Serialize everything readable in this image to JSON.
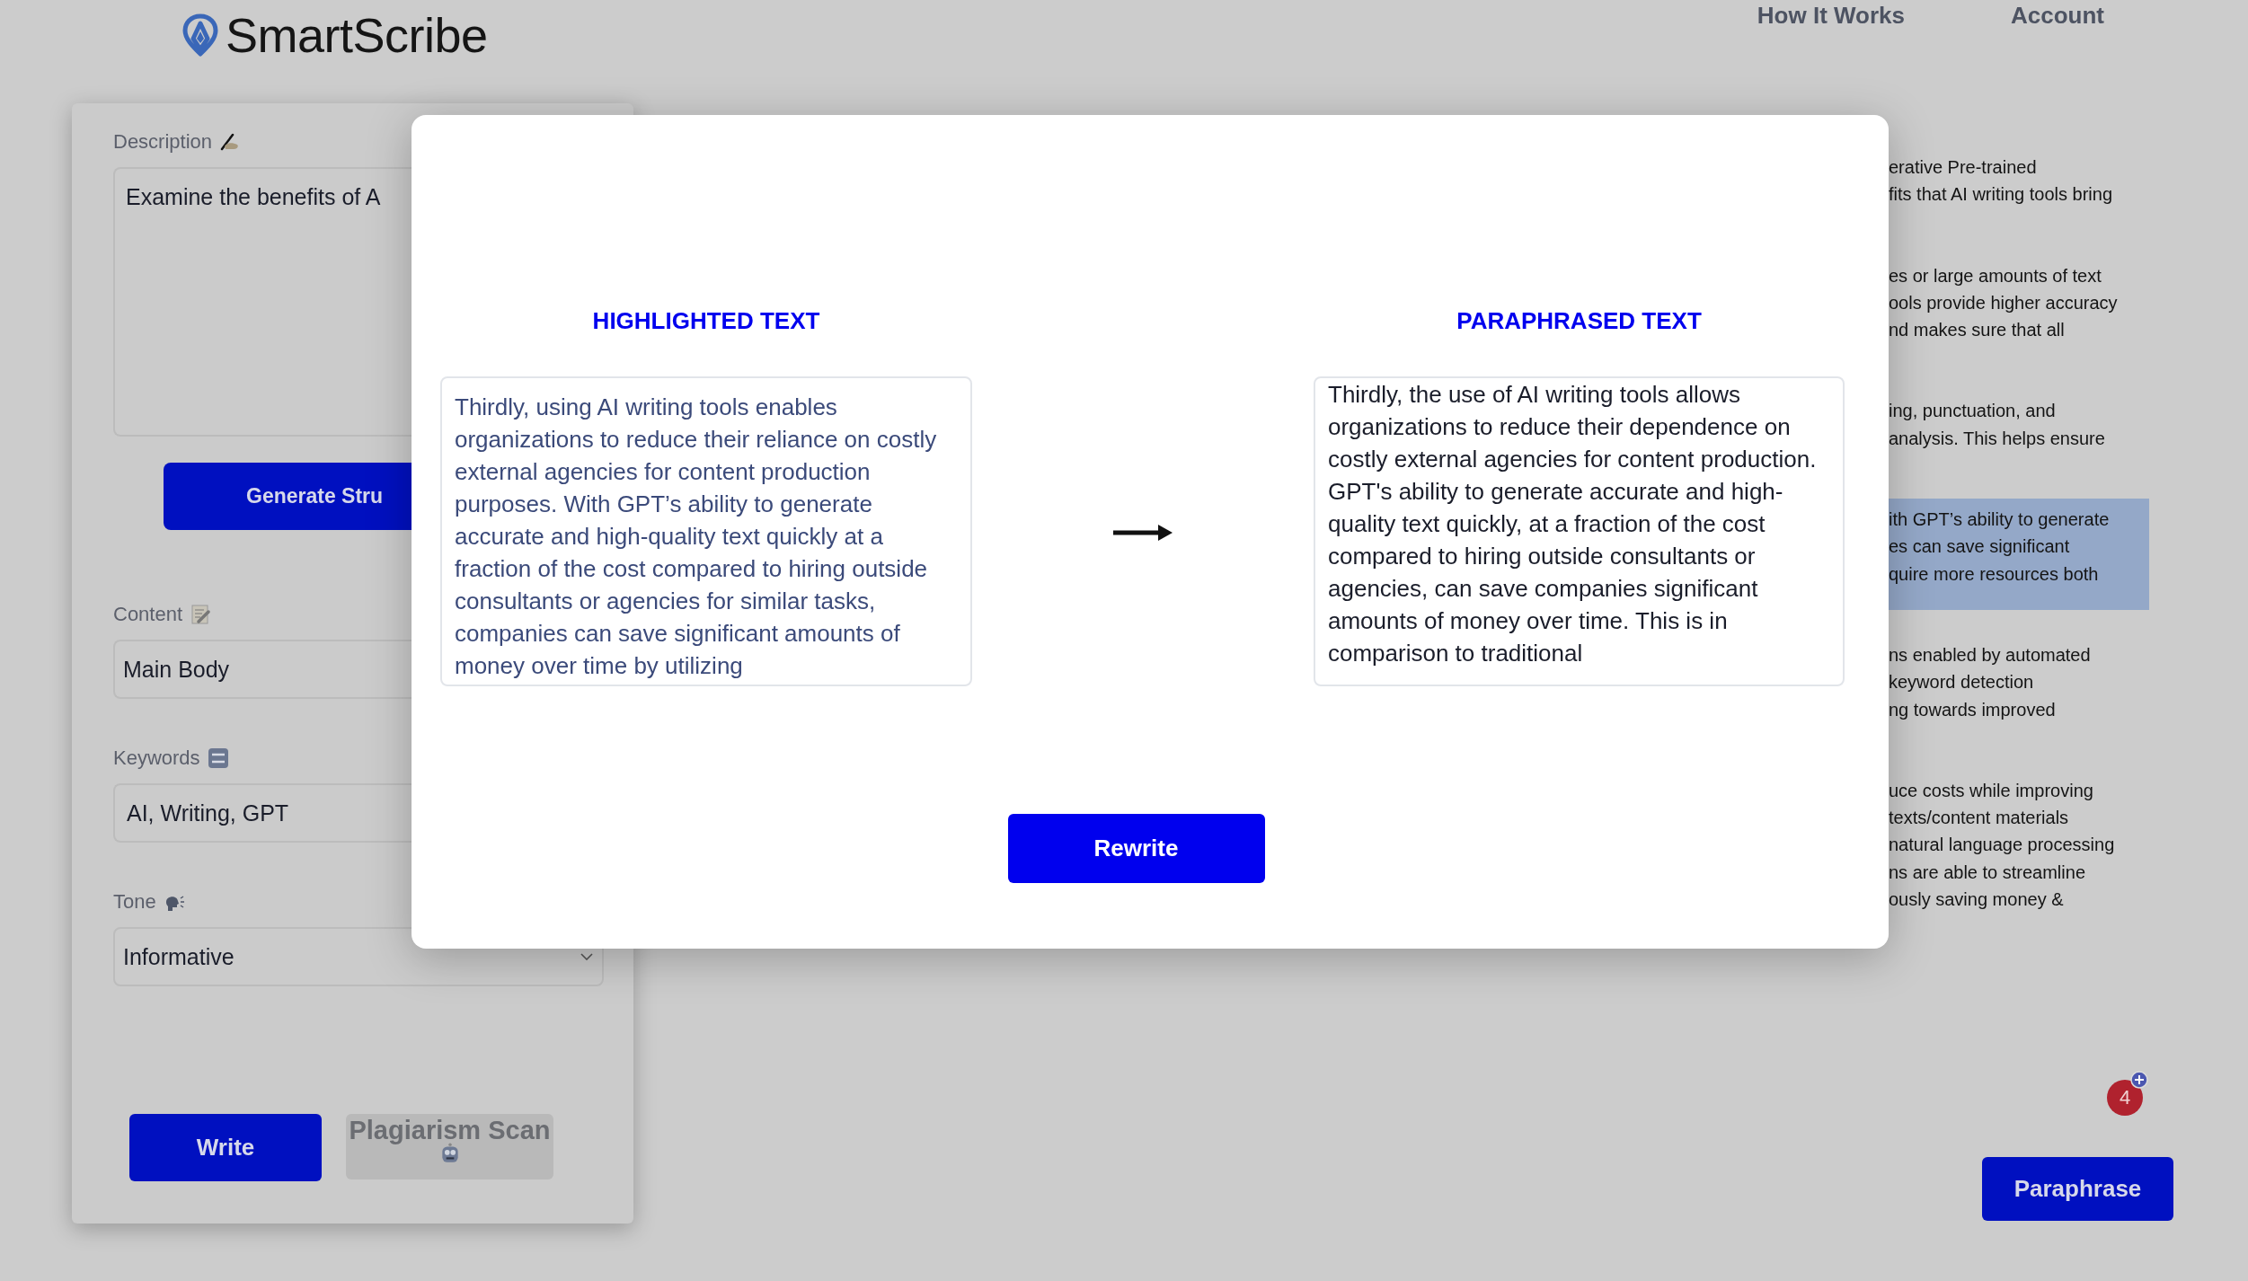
{
  "header": {
    "logo": "**Smart**Scribe",
    "nav": [
      {
        "label": "How It Works"
      },
      {
        "label": "Account"
      }
    ]
  },
  "form": {
    "description": {
      "label": "Description",
      "value": "Examine the benefits of A"
    },
    "generate_button": "Generate Stru",
    "content": {
      "label": "Content",
      "value": "Main Body"
    },
    "keywords": {
      "label": "Keywords",
      "value": "AI, Writing, GPT"
    },
    "tone": {
      "label": "Tone",
      "value": "Informative"
    },
    "buttons": [
      {
        "label": "Write",
        "kind": "plain",
        "disabled": false
      },
      {
        "label": "Plagiarism Scan",
        "kind": "robot",
        "disabled": true
      }
    ]
  },
  "document": {
    "paragraphs": [
      {
        "lines": [
          "erative Pre-trained",
          "fits that AI writing tools bring"
        ],
        "highlighted": false
      },
      {
        "lines": [
          "es or large amounts of text",
          "ools provide higher accuracy",
          "nd makes sure that all"
        ],
        "highlighted": false
      },
      {
        "lines": [
          "ing, punctuation, and",
          "analysis. This helps ensure"
        ],
        "highlighted": false
      },
      {
        "lines": [
          "ith GPT’s ability to generate",
          "es can save significant",
          "quire more resources both"
        ],
        "highlighted": true
      },
      {
        "lines": [
          "ns enabled by automated",
          "keyword detection",
          "ng towards improved"
        ],
        "highlighted": false
      },
      {
        "lines": [
          "uce costs while improving",
          "texts/content materials",
          "natural language processing",
          "ns are able to streamline",
          "ously saving money &"
        ],
        "highlighted": false
      }
    ]
  },
  "notification": {
    "count": "4"
  },
  "paraphrase_button": "Paraphrase",
  "modal": {
    "source": {
      "title": "HIGHLIGHTED TEXT",
      "text": "Thirdly, using AI writing tools enables organizations to reduce their reliance on costly external agencies for content production purposes. With GPT’s ability to generate accurate and high-quality text quickly at a fraction of the cost compared to hiring outside consultants or agencies for similar tasks, companies can save significant amounts of money over time by utilizing"
    },
    "result": {
      "title": "PARAPHRASED TEXT",
      "text": "Thirdly, the use of AI writing tools allows organizations to reduce their dependence on costly external agencies for content production. GPT's ability to generate accurate and high-quality text quickly, at a fraction of the cost compared to hiring outside consultants or agencies, can save companies significant amounts of money over time. This is in comparison to traditional"
    },
    "button": "Rewrite"
  }
}
